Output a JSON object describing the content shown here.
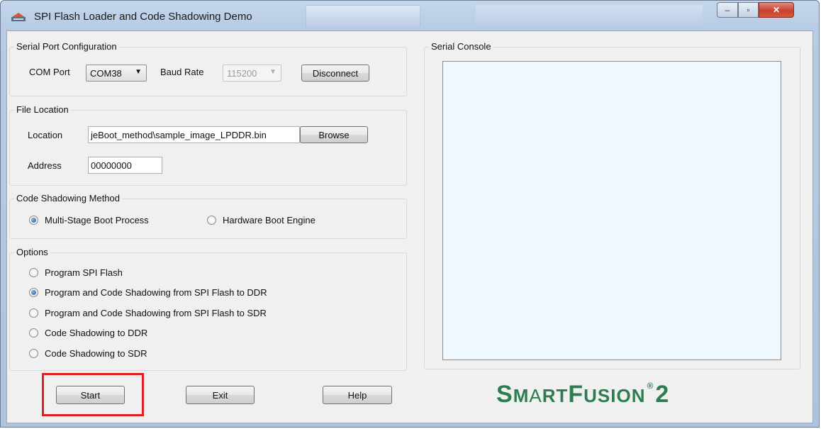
{
  "window": {
    "title": "SPI Flash Loader and Code Shadowing Demo",
    "controls": {
      "minimize": "–",
      "maximize": "▫",
      "close": "✕"
    }
  },
  "serial_port": {
    "group_title": "Serial Port Configuration",
    "com_label": "COM Port",
    "com_value": "COM38",
    "baud_label": "Baud Rate",
    "baud_value": "115200",
    "disconnect": "Disconnect"
  },
  "file_location": {
    "group_title": "File Location",
    "location_label": "Location",
    "location_value": "jeBoot_method\\sample_image_LPDDR.bin",
    "browse": "Browse",
    "address_label": "Address",
    "address_value": "00000000"
  },
  "shadow_method": {
    "group_title": "Code Shadowing Method",
    "options": [
      {
        "label": "Multi-Stage Boot Process",
        "checked": true
      },
      {
        "label": "Hardware Boot Engine",
        "checked": false
      }
    ]
  },
  "options": {
    "group_title": "Options",
    "items": [
      {
        "label": "Program SPI Flash",
        "checked": false
      },
      {
        "label": "Program and Code Shadowing from SPI Flash to DDR",
        "checked": true
      },
      {
        "label": "Program and Code Shadowing from SPI Flash to SDR",
        "checked": false
      },
      {
        "label": "Code Shadowing to DDR",
        "checked": false
      },
      {
        "label": "Code Shadowing to SDR",
        "checked": false
      }
    ]
  },
  "console": {
    "group_title": "Serial Console"
  },
  "buttons": {
    "start": "Start",
    "exit": "Exit",
    "help": "Help"
  },
  "logo": {
    "s": "S",
    "mart": "M",
    "a": "A",
    "rt": "RT",
    "f": "F",
    "usion": "USION",
    "reg": "®",
    "two": "2"
  },
  "colors": {
    "highlight": "#e0201e",
    "logo": "#2e7d52",
    "console_bg": "#f0f8ff"
  }
}
